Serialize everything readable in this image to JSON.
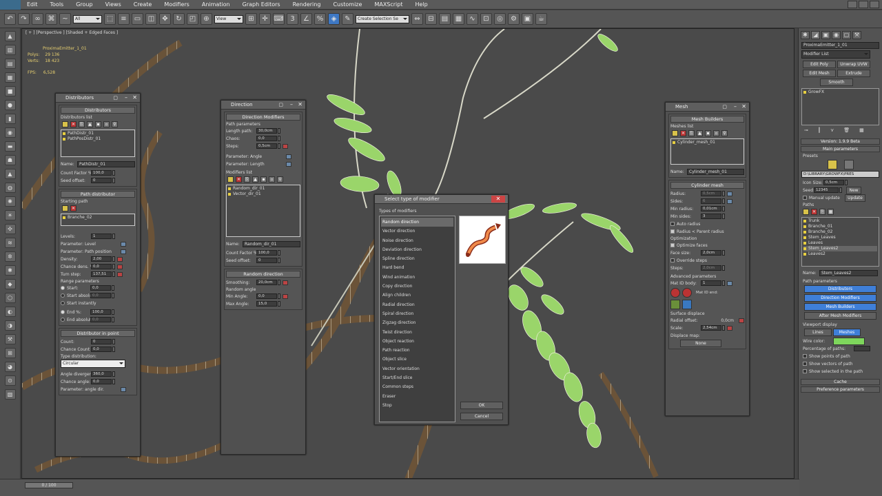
{
  "menu": [
    "Edit",
    "Tools",
    "Group",
    "Views",
    "Create",
    "Modifiers",
    "Animation",
    "Graph Editors",
    "Rendering",
    "Customize",
    "MAXScript",
    "Help"
  ],
  "toolbar": {
    "selection_filter": "All",
    "view": "View",
    "selection_set": "Create Selection Se"
  },
  "viewport": {
    "label": "[ + ] [Perspective ] [Shaded + Edged Faces ]",
    "stats_object": "ProximaEmitter_1_01",
    "polys_label": "Polys:",
    "polys_value": "29 136",
    "verts_label": "Verts:",
    "verts_value": "18 423",
    "fps_label": "FPS:",
    "fps_value": "6,528"
  },
  "distributors": {
    "title": "Distributors",
    "rollout": "Distributors",
    "list_label": "Distributors list",
    "items": [
      "PathDistr_01",
      "PathPosDistr_01"
    ],
    "name_label": "Name:",
    "name_value": "PathDistr_01",
    "count_label": "Count Factor %:",
    "count_value": "100,0",
    "seed_label": "Seed offset:",
    "seed_value": "0",
    "path_rollout": "Path distributor",
    "starting_path_label": "Starting path",
    "starting_path_value": "Branche_02",
    "levels_label": "Levels:",
    "levels_value": "1",
    "param_level": "Parameter: Level",
    "param_path_position": "Parameter: Path position",
    "density_label": "Density:",
    "density_value": "2,00",
    "chance_dens_label": "Chance dens. %:",
    "chance_dens_value": "0,0",
    "turn_step_label": "Turn step:",
    "turn_step_value": "137,51",
    "range_label": "Range parameters",
    "start_label": "Start:",
    "start_value": "0,0",
    "start_absolute_label": "Start absolute:",
    "start_absolute_value": "0,0",
    "start_instantly": "Start instantly",
    "end_label": "End %:",
    "end_value": "100,0",
    "end_absolute_label": "End absolute:",
    "end_absolute_value": "0,0",
    "in_point_rollout": "Distributor in point",
    "ip_count_label": "Count:",
    "ip_count_value": "0",
    "ip_chance_label": "Chance Count %:",
    "ip_chance_value": "0,0",
    "type_label": "Type distribution:",
    "type_value": "Circular",
    "angle_div_label": "Angle divergence:",
    "angle_div_value": "360,0",
    "chance_angle_label": "Chance angle:",
    "chance_angle_value": "0,0",
    "param_angle_dir": "Parameter: angle dir."
  },
  "direction": {
    "title": "Direction",
    "rollout": "Direction Modifiers",
    "path_params": "Path parameters",
    "length_label": "Length path:",
    "length_value": "30,0cm",
    "chaos_label": "Chaos:",
    "chaos_value": "0,0",
    "steps_label": "Steps:",
    "steps_value": "0,5cm",
    "param_angle": "Parameter: Angle",
    "param_length": "Parameter: Length",
    "mod_list_label": "Modifiers list",
    "items": [
      "Random_dir_01",
      "Vector_dir_01"
    ],
    "name_label": "Name:",
    "name_value": "Random_dir_01",
    "count_label": "Count Factor %:",
    "count_value": "100,0",
    "seed_label": "Seed offset:",
    "seed_value": "0",
    "rand_rollout": "Random direction",
    "smoothing_label": "Smoothing:",
    "smoothing_value": "20,0cm",
    "rand_angle": "Random angle",
    "min_label": "Min Angle:",
    "min_value": "0,0",
    "max_label": "Max Angle:",
    "max_value": "15,0"
  },
  "dialog": {
    "title": "Select type of modifier",
    "group": "Types of modifiers",
    "options": [
      "Random direction",
      "Vector direction",
      "Noise direction",
      "Deviation direction",
      "Spline direction",
      "Hard bend",
      "Wind animation",
      "Copy direction",
      "Align children",
      "Radial direction",
      "Spiral direction",
      "Zigzag direction",
      "Twist direction",
      "Object reaction",
      "Path reaction",
      "Object slice",
      "Vector orientation",
      "Start/End slice",
      "Common steps",
      "Eraser",
      "Stop"
    ],
    "selected_index": 0,
    "ok": "OK",
    "cancel": "Cancel"
  },
  "mesh": {
    "title": "Mesh",
    "rollout": "Mesh Builders",
    "list_label": "Meshes list",
    "items": [
      "Cylinder_mesh_01"
    ],
    "name_label": "Name:",
    "name_value": "Cylinder_mesh_01",
    "cyl_rollout": "Cylinder mesh",
    "radius_label": "Radius:",
    "radius_value": "0,5cm",
    "sides_label": "Sides:",
    "sides_value": "6",
    "min_radius_label": "Min radius:",
    "min_radius_value": "0,01cm",
    "min_sides_label": "Min sides:",
    "min_sides_value": "3",
    "auto_radius": "Auto radius",
    "radius_parent": "Radius < Parent radius",
    "optimization": "Optimization",
    "optimize_faces": "Optimize faces",
    "face_size_label": "Face size:",
    "face_size_value": "2,0cm",
    "override_steps": "Override steps",
    "steps_label": "Steps:",
    "steps_value": "2,0cm",
    "adv_label": "Advanced parameters",
    "mat_id_label": "Mat ID body:",
    "mat_id_value": "1",
    "mat_id2_label": "Mat ID end:",
    "surf_label": "Surface displace",
    "radial_offset_label": "Radial offset:",
    "radial_offset_value": "0,0cm",
    "scale_label": "Scale:",
    "scale_value": "2,54cm",
    "displace_map_label": "Displace map:",
    "displace_map_value": "None"
  },
  "cmd": {
    "object_name": "ProximaEmitter_1_01",
    "modifier_list": "Modifier List",
    "buttons": [
      "Edit Poly",
      "Unwrap UVW",
      "Edit Mesh",
      "Extrude",
      "Smooth"
    ],
    "stack_item": "GrowFX",
    "version": "Version: 1.9.9 Beta",
    "main_params": "Main parameters",
    "presets": "Presets",
    "preset_path": "D:\\LIBRARY\\GROWFX\\PRES",
    "icon_size_label": "Icon Size:",
    "icon_size_value": "0,5cm",
    "seed_label": "Seed:",
    "seed_value": "12345",
    "new": "New",
    "manual_update": "Manual update",
    "update": "Update",
    "paths_label": "Paths",
    "paths": [
      "Trunk",
      "Branche_01",
      "Branche_02",
      "Stem_Leaves",
      "Leaves",
      "Stem_Leaves2",
      "Leaves2"
    ],
    "selected_path_index": 5,
    "name_label": "Name:",
    "name_value": "Stem_Leaves2",
    "path_params": "Path parameters",
    "distributors_btn": "Distributors",
    "direction_btn": "Direction Modifiers",
    "mesh_btn": "Mesh Builders",
    "after_mesh_btn": "After Mesh Modifiers",
    "viewport_display": "Viewport display",
    "lines": "Lines",
    "meshes": "Meshes",
    "wire_color": "Wire color:",
    "percentage": "Percentage of paths:",
    "show_points": "Show points of path",
    "show_vectors": "Show vectors of path",
    "show_selected": "Show selected in the path",
    "cache": "Cache",
    "preference": "Preference parameters"
  },
  "status": {
    "time": "0 / 100"
  },
  "colors": {
    "accent_blue": "#3f7fd8",
    "leaf_green": "#7ed65c",
    "list_dot": "#e8d040"
  }
}
